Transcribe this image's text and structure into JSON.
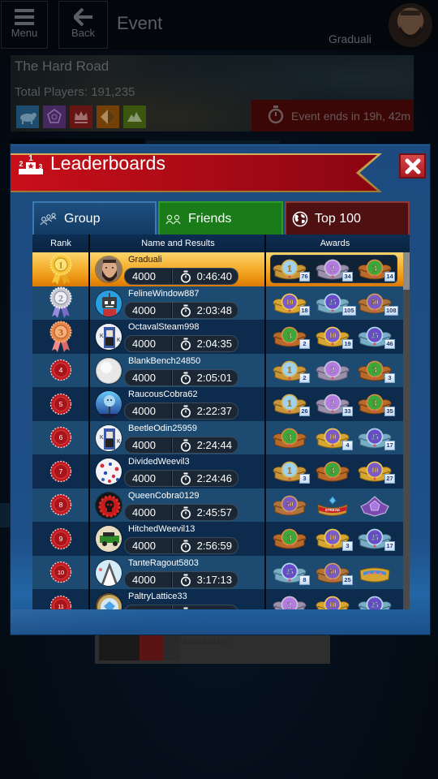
{
  "topbar": {
    "menu_label": "Menu",
    "back_label": "Back",
    "title": "Event",
    "username": "Graduali"
  },
  "event": {
    "name": "The Hard Road",
    "total_players": "Total Players: 191,235",
    "game_modes": [
      "klondike",
      "spider",
      "freecell",
      "pyramid",
      "tripeaks"
    ],
    "timer_text": "Event ends in 19h, 42m"
  },
  "modal": {
    "title": "Leaderboards"
  },
  "tabs": [
    {
      "label": "Group",
      "icon": "group-icon",
      "selected": true
    },
    {
      "label": "Friends",
      "icon": "friends-icon",
      "selected": false
    },
    {
      "label": "Top 100",
      "icon": "globe-icon",
      "selected": false
    }
  ],
  "table": {
    "headers": {
      "rank": "Rank",
      "name": "Name and Results",
      "awards": "Awards"
    },
    "scroll_fraction": 0
  },
  "award_types": {
    "first": {
      "label": "1"
    },
    "second": {
      "label": "2"
    },
    "third": {
      "label": "3"
    },
    "top10": {
      "label": "10"
    },
    "top25": {
      "label": "25"
    },
    "top50": {
      "label": "50"
    },
    "streak": {
      "label": "STREAK"
    },
    "pentagon": {
      "label": ""
    },
    "gem": {
      "label": ""
    }
  },
  "colors": {
    "highlight_row": "#f6b030",
    "tab_group": "#1e4f7f",
    "tab_friends": "#1a7c18",
    "tab_top100": "#4e1010",
    "ribbon": "#c80f1a",
    "modal": "#1e4f87"
  },
  "rows": [
    {
      "rank": "1",
      "name": "Graduali",
      "score": "4000",
      "time": "0:46:40",
      "avatar": "bearded-man",
      "highlight": true,
      "awards": [
        {
          "type": "first",
          "count": "76"
        },
        {
          "type": "second",
          "count": "34"
        },
        {
          "type": "third",
          "count": "14"
        }
      ]
    },
    {
      "rank": "2",
      "name": "FelineWindow887",
      "score": "4000",
      "time": "2:03:48",
      "avatar": "robot",
      "awards": [
        {
          "type": "top10",
          "count": "18"
        },
        {
          "type": "top25",
          "count": "105"
        },
        {
          "type": "top50",
          "count": "108"
        }
      ]
    },
    {
      "rank": "3",
      "name": "OctavalSteam998",
      "score": "4000",
      "time": "2:04:35",
      "avatar": "card-king",
      "awards": [
        {
          "type": "third",
          "count": "2"
        },
        {
          "type": "top10",
          "count": "19"
        },
        {
          "type": "top25",
          "count": "46"
        }
      ]
    },
    {
      "rank": "4",
      "name": "BlankBench24850",
      "score": "4000",
      "time": "2:05:01",
      "avatar": "white-ball",
      "awards": [
        {
          "type": "first",
          "count": "2"
        },
        {
          "type": "second",
          "count": null
        },
        {
          "type": "third",
          "count": "3"
        }
      ]
    },
    {
      "rank": "5",
      "name": "RaucousCobra62",
      "score": "4000",
      "time": "2:22:37",
      "avatar": "sky-character",
      "awards": [
        {
          "type": "first",
          "count": "26"
        },
        {
          "type": "second",
          "count": "33"
        },
        {
          "type": "third",
          "count": "35"
        }
      ]
    },
    {
      "rank": "6",
      "name": "BeetleOdin25959",
      "score": "4000",
      "time": "2:24:44",
      "avatar": "card-king",
      "awards": [
        {
          "type": "third",
          "count": null
        },
        {
          "type": "top10",
          "count": "4"
        },
        {
          "type": "top25",
          "count": "17"
        }
      ]
    },
    {
      "rank": "7",
      "name": "DividedWeevil3",
      "score": "4000",
      "time": "2:24:46",
      "avatar": "confetti",
      "awards": [
        {
          "type": "first",
          "count": "3"
        },
        {
          "type": "third",
          "count": null
        },
        {
          "type": "top10",
          "count": "27"
        }
      ]
    },
    {
      "rank": "8",
      "name": "QueenCobra0129",
      "score": "4000",
      "time": "2:45:57",
      "avatar": "gear-skull",
      "awards": [
        {
          "type": "top50",
          "count": null
        },
        {
          "type": "streak",
          "count": null
        },
        {
          "type": "pentagon",
          "count": null
        }
      ]
    },
    {
      "rank": "9",
      "name": "HitchedWeevil13",
      "score": "4000",
      "time": "2:56:59",
      "avatar": "jeep",
      "awards": [
        {
          "type": "third",
          "count": null
        },
        {
          "type": "top10",
          "count": "3"
        },
        {
          "type": "top25",
          "count": "17"
        }
      ]
    },
    {
      "rank": "10",
      "name": "TanteRagout5803",
      "score": "4000",
      "time": "3:17:13",
      "avatar": "ghost-wizard",
      "awards": [
        {
          "type": "top25",
          "count": "8"
        },
        {
          "type": "top50",
          "count": "25"
        },
        {
          "type": "gem",
          "count": null
        }
      ]
    },
    {
      "rank": "11",
      "name": "PaltryLattice33",
      "score": "",
      "time": "",
      "avatar": "gem-ring",
      "awards": [
        {
          "type": "second",
          "count": null
        },
        {
          "type": "top10",
          "count": null
        },
        {
          "type": "top25",
          "count": null
        }
      ]
    }
  ],
  "background_card": {
    "text": "□□□□□□□□□□"
  }
}
